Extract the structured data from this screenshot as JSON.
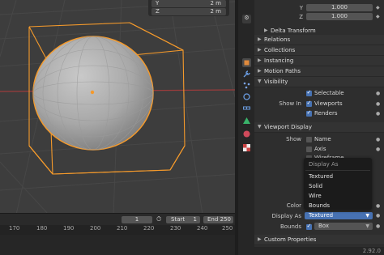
{
  "dimensions": {
    "rows": [
      {
        "axis": "Y",
        "value": "2 m"
      },
      {
        "axis": "Z",
        "value": "2 m"
      }
    ]
  },
  "transform": {
    "rows": [
      {
        "axis": "Y",
        "value": "1.000"
      },
      {
        "axis": "Z",
        "value": "1.000"
      }
    ]
  },
  "sections": {
    "delta_transform": "Delta Transform",
    "relations": "Relations",
    "collections": "Collections",
    "instancing": "Instancing",
    "motion_paths": "Motion Paths",
    "visibility": "Visibility",
    "viewport_display": "Viewport Display",
    "custom_properties": "Custom Properties"
  },
  "visibility": {
    "selectable": "Selectable",
    "show_in_label": "Show In",
    "viewports": "Viewports",
    "renders": "Renders"
  },
  "viewport_display": {
    "show_label": "Show",
    "name": "Name",
    "axis": "Axis",
    "wireframe": "Wireframe",
    "color_label": "Color",
    "display_as_label": "Display As",
    "display_as_value": "Textured",
    "bounds_label": "Bounds",
    "bounds_value": "Box"
  },
  "display_as_menu": {
    "title": "Display As",
    "options": [
      "Textured",
      "Solid",
      "Wire",
      "Bounds"
    ]
  },
  "timeline": {
    "current_frame": "1",
    "start_label": "Start",
    "start_value": "1",
    "end_label": "End",
    "end_value": "250",
    "ticks": [
      "170",
      "180",
      "190",
      "200",
      "210",
      "220",
      "230",
      "240",
      "250"
    ]
  },
  "status": {
    "version": "2.92.0"
  },
  "colors": {
    "selection_orange": "#f59a2b",
    "accent_blue": "#4772b3",
    "axis_red": "#9b3c3c"
  },
  "icons": {
    "object_tab": "object-properties-icon",
    "modifier_tab": "wrench-icon",
    "particles_tab": "particles-icon",
    "physics_tab": "physics-icon",
    "constraints_tab": "constraints-icon",
    "data_tab": "mesh-data-icon",
    "material_tab": "material-icon",
    "texture_tab": "texture-icon"
  }
}
